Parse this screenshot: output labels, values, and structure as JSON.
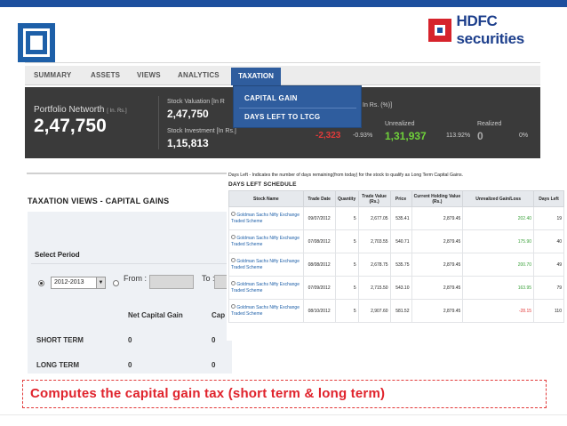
{
  "brand": {
    "name": "HDFC securities",
    "accent": "#1d4f9e",
    "red": "#d6232c"
  },
  "nav": {
    "items": [
      "SUMMARY",
      "ASSETS",
      "VIEWS",
      "ANALYTICS"
    ],
    "active": "TAXATION"
  },
  "dropdown": {
    "items": [
      "CAPITAL GAIN",
      "DAYS LEFT TO LTCG"
    ]
  },
  "dashboard": {
    "portfolio_label": "Portfolio Networth",
    "portfolio_unit": "[ In. Rs.]",
    "portfolio_value": "2,47,750",
    "stock_valuation_label": "Stock Valuation",
    "stock_valuation_unit": "[In R",
    "stock_valuation_value": "2,47,750",
    "stock_investment_label": "Stock Investment",
    "stock_investment_unit": "[In Rs.]",
    "stock_investment_value": "1,15,813",
    "unit_pct": "In Rs. (%)]",
    "gain_loss_value": "-2,323",
    "gain_loss_pct": "-0.93%",
    "unrealized_label": "Unrealized",
    "unrealized_value": "1,31,937",
    "unrealized_pct": "113.92%",
    "realized_label": "Realized",
    "realized_value": "0",
    "realized_pct": "0%"
  },
  "taxation": {
    "title": "TAXATION VIEWS - CAPITAL GAINS",
    "select_period_label": "Select Period",
    "year_selected": "2012-2013",
    "from_label": "From :",
    "to_label": "To :",
    "col_net": "Net Capital Gain",
    "col_cap": "Cap",
    "rows": [
      {
        "label": "SHORT TERM",
        "v1": "0",
        "v2": "0"
      },
      {
        "label": "LONG TERM",
        "v1": "0",
        "v2": "0"
      }
    ]
  },
  "popup": {
    "note": "Days Left - Indicates the number of days remaining(from today) for the stock to qualify as Long Term Capital Gains.",
    "title": "DAYS LEFT SCHEDULE",
    "headers": [
      "Stock Name",
      "Trade Date",
      "Quantity",
      "Trade Value (Rs.)",
      "Price",
      "Current Holding Value (Rs.)",
      "Unrealized Gain/Loss",
      "Days Left"
    ],
    "rows": [
      {
        "name": "Goldman Sachs Nifty Exchange Traded Scheme",
        "date": "09/07/2012",
        "qty": "5",
        "value": "2,677.05",
        "price": "535.41",
        "holding": "2,879.45",
        "gain": "202.40",
        "days": "19"
      },
      {
        "name": "Goldman Sachs Nifty Exchange Traded Scheme",
        "date": "07/08/2012",
        "qty": "5",
        "value": "2,703.55",
        "price": "540.71",
        "holding": "2,879.45",
        "gain": "175.90",
        "days": "40"
      },
      {
        "name": "Goldman Sachs Nifty Exchange Traded Scheme",
        "date": "08/08/2012",
        "qty": "5",
        "value": "2,678.75",
        "price": "535.75",
        "holding": "2,879.45",
        "gain": "200.70",
        "days": "49"
      },
      {
        "name": "Goldman Sachs Nifty Exchange Traded Scheme",
        "date": "07/09/2012",
        "qty": "5",
        "value": "2,715.50",
        "price": "543.10",
        "holding": "2,879.45",
        "gain": "163.95",
        "days": "79"
      },
      {
        "name": "Goldman Sachs Nifty Exchange Traded Scheme",
        "date": "08/10/2012",
        "qty": "5",
        "value": "2,907.60",
        "price": "581.52",
        "holding": "2,879.45",
        "gain": "-28.15",
        "days": "110"
      }
    ]
  },
  "caption": "Computes the capital gain tax (short term & long term)"
}
